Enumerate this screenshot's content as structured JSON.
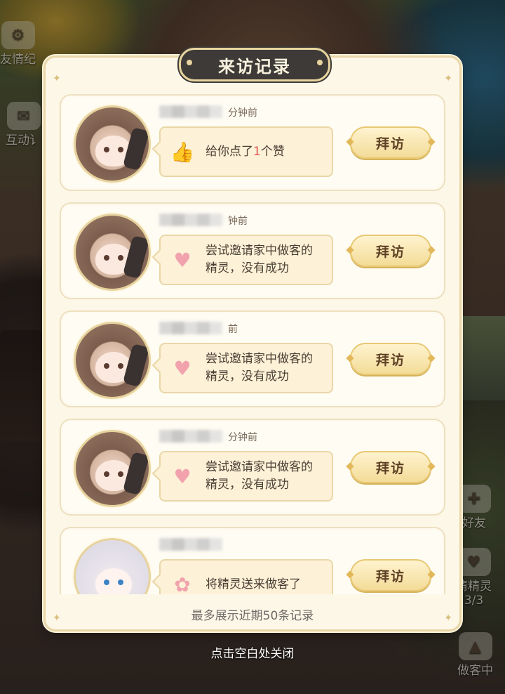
{
  "panel": {
    "title": "来访记录",
    "footer_note": "最多展示近期50条记录",
    "visit_label": "拜访"
  },
  "records": [
    {
      "time": "分钟前",
      "message": "给你点了",
      "count": "1",
      "suffix": "个赞",
      "icon": "thumbs-up-icon",
      "avatar": "brown-haired-girl"
    },
    {
      "time": "钟前",
      "message": "尝试邀请家中做客的",
      "message2": "精灵，没有成功",
      "icon": "heart-icon",
      "avatar": "brown-haired-girl"
    },
    {
      "time": "前",
      "message": "尝试邀请家中做客的",
      "message2": "精灵，没有成功",
      "icon": "heart-icon",
      "avatar": "brown-haired-girl"
    },
    {
      "time": "分钟前",
      "message": "尝试邀请家中做客的",
      "message2": "精灵，没有成功",
      "icon": "heart-icon",
      "avatar": "brown-haired-girl"
    },
    {
      "time": "",
      "message": "将精灵送来做客了",
      "icon": "sprite-icon",
      "avatar": "white-haired-girl"
    }
  ],
  "close_hint": "点击空白处关闭",
  "background": {
    "left_top": "友情纪",
    "left_mid": "互动讠",
    "right_friend": "好友",
    "right_sprite": "情精灵",
    "right_sprite_count": "3/3",
    "right_bottom": "做客中"
  }
}
